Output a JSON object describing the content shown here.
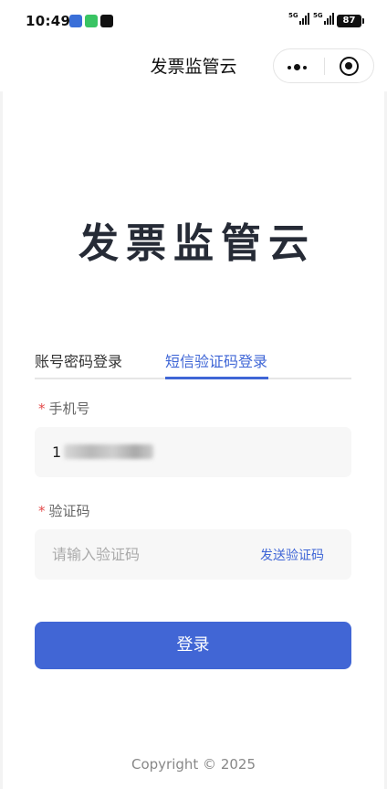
{
  "status_bar": {
    "time": "10:49",
    "network_1": "5G",
    "network_2": "5G",
    "battery": "87",
    "app_icon_colors": [
      "#3a6fd8",
      "#39c463",
      "#111111"
    ]
  },
  "nav": {
    "title": "发票监管云"
  },
  "logo": {
    "text": "发票监管云"
  },
  "tabs": [
    {
      "label": "账号密码登录",
      "active": false
    },
    {
      "label": "短信验证码登录",
      "active": true
    }
  ],
  "form": {
    "phone": {
      "required_mark": "*",
      "label": "手机号",
      "value": "1"
    },
    "code": {
      "required_mark": "*",
      "label": "验证码",
      "placeholder": "请输入验证码",
      "send_label": "发送验证码"
    }
  },
  "login_button": {
    "label": "登录"
  },
  "footer": {
    "copyright": "Copyright © 2025"
  },
  "colors": {
    "accent": "#4166d5",
    "required": "#e34a4a",
    "logo": "#262b36"
  }
}
